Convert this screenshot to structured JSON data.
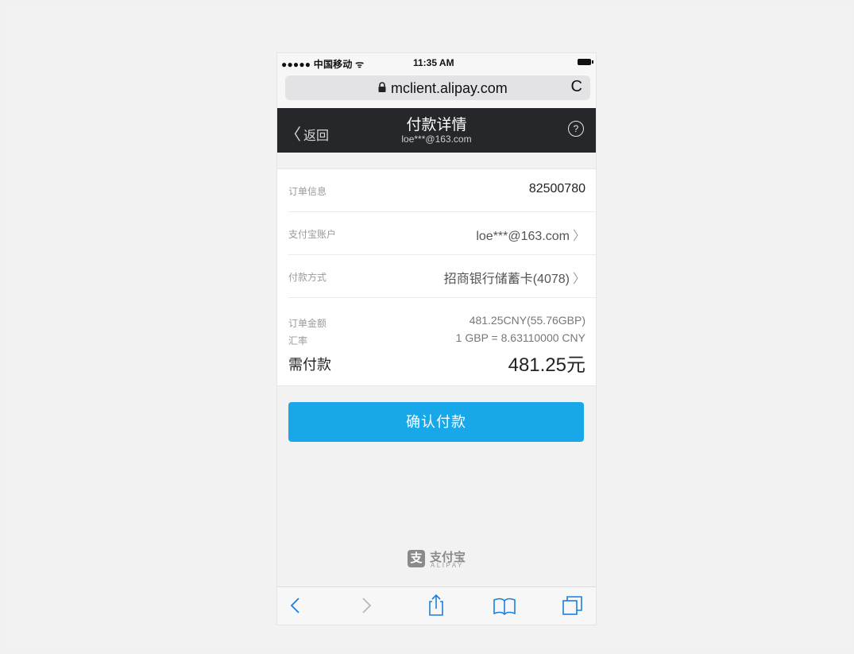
{
  "status_bar": {
    "carrier": "●●●●● 中国移动 ᯤ",
    "time": "11:35 AM"
  },
  "browser": {
    "url": "mclient.alipay.com",
    "reload_icon": "reload-icon",
    "lock_icon": "lock-icon"
  },
  "nav": {
    "back_label": "返回",
    "title": "付款详情",
    "subtitle": "loe***@163.com",
    "help_glyph": "?"
  },
  "rows": [
    {
      "label": "订单信息",
      "value": "82500780"
    },
    {
      "label": "支付宝账户",
      "value": "loe***@163.com"
    },
    {
      "label": "付款方式",
      "value": "招商银行储蓄卡(4078)"
    }
  ],
  "amounts": {
    "order_amount_label": "订单金额",
    "order_amount_value": "481.25CNY(55.76GBP)",
    "rate_label": "汇率",
    "rate_value": "1 GBP = 8.63110000 CNY",
    "due_label": "需付款",
    "due_value": "481.25元"
  },
  "confirm_button": "确认付款",
  "logo": {
    "mark": "支",
    "cn": "支付宝",
    "en": "ALIPAY"
  },
  "colors": {
    "accent": "#18a7e8",
    "navbar": "#25272b",
    "background": "#f2f2f2"
  }
}
